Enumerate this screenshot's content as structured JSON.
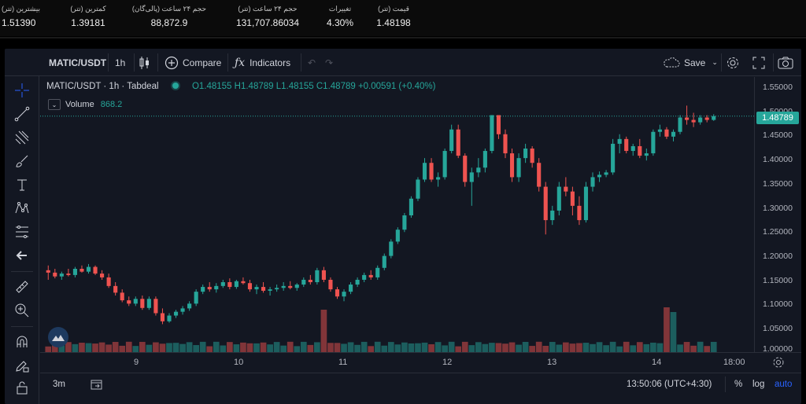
{
  "stats": [
    {
      "label": "بیشترین (تتر)",
      "value": "1.51390"
    },
    {
      "label": "کمترین (تتر)",
      "value": "1.39181"
    },
    {
      "label": "حجم ۲۴ ساعت (پالی‌گان)",
      "value": "88,872.9"
    },
    {
      "label": "حجم ۲۴ ساعت (تتر)",
      "value": "131,707.86034"
    },
    {
      "label": "تغییرات",
      "value": "4.30%"
    },
    {
      "label": "قیمت (تتر)",
      "value": "1.48198"
    }
  ],
  "toolbar": {
    "symbol": "MATIC/USDT",
    "interval": "1h",
    "compare": "Compare",
    "indicators": "Indicators",
    "save": "Save"
  },
  "legend": {
    "title": "MATIC/USDT · 1h · Tabdeal",
    "ohlc": "O1.48155  H1.48789  L1.48155  C1.48789  +0.00591 (+0.40%)",
    "volume_label": "Volume",
    "volume_value": "868.2"
  },
  "price_axis": {
    "last_price": "1.48789",
    "ticks": [
      "1.55000",
      "1.50000",
      "1.45000",
      "1.40000",
      "1.35000",
      "1.30000",
      "1.25000",
      "1.20000",
      "1.15000",
      "1.10000",
      "1.05000",
      "1.00000"
    ]
  },
  "time_axis": [
    "9",
    "10",
    "11",
    "12",
    "13",
    "14",
    "18:00"
  ],
  "bottom": {
    "range": "3m",
    "clock": "13:50:06 (UTC+4:30)",
    "percent": "%",
    "log": "log",
    "auto": "auto"
  },
  "colors": {
    "up": "#26a69a",
    "down": "#ef5350",
    "background": "#131722",
    "accent": "#2962ff"
  },
  "chart_data": {
    "type": "candlestick",
    "ylim": [
      1.0,
      1.56
    ],
    "x_ticks": [
      "9",
      "10",
      "11",
      "12",
      "13",
      "14",
      "18:00"
    ],
    "candles": [
      [
        1.165,
        1.175,
        1.145,
        1.16
      ],
      [
        1.16,
        1.168,
        1.148,
        1.152
      ],
      [
        1.152,
        1.162,
        1.145,
        1.158
      ],
      [
        1.158,
        1.168,
        1.152,
        1.155
      ],
      [
        1.155,
        1.172,
        1.15,
        1.168
      ],
      [
        1.168,
        1.175,
        1.16,
        1.162
      ],
      [
        1.162,
        1.178,
        1.158,
        1.172
      ],
      [
        1.172,
        1.175,
        1.155,
        1.158
      ],
      [
        1.158,
        1.165,
        1.145,
        1.15
      ],
      [
        1.15,
        1.158,
        1.128,
        1.132
      ],
      [
        1.132,
        1.14,
        1.112,
        1.118
      ],
      [
        1.118,
        1.125,
        1.098,
        1.102
      ],
      [
        1.102,
        1.11,
        1.09,
        1.095
      ],
      [
        1.095,
        1.11,
        1.09,
        1.105
      ],
      [
        1.105,
        1.112,
        1.082,
        1.086
      ],
      [
        1.086,
        1.11,
        1.082,
        1.105
      ],
      [
        1.105,
        1.11,
        1.07,
        1.075
      ],
      [
        1.075,
        1.085,
        1.052,
        1.058
      ],
      [
        1.058,
        1.075,
        1.055,
        1.07
      ],
      [
        1.07,
        1.082,
        1.065,
        1.078
      ],
      [
        1.078,
        1.09,
        1.072,
        1.085
      ],
      [
        1.085,
        1.1,
        1.08,
        1.095
      ],
      [
        1.095,
        1.125,
        1.09,
        1.12
      ],
      [
        1.12,
        1.135,
        1.115,
        1.13
      ],
      [
        1.13,
        1.14,
        1.12,
        1.125
      ],
      [
        1.125,
        1.138,
        1.118,
        1.132
      ],
      [
        1.132,
        1.145,
        1.128,
        1.14
      ],
      [
        1.14,
        1.148,
        1.125,
        1.13
      ],
      [
        1.13,
        1.145,
        1.126,
        1.142
      ],
      [
        1.142,
        1.15,
        1.135,
        1.138
      ],
      [
        1.138,
        1.145,
        1.12,
        1.125
      ],
      [
        1.125,
        1.135,
        1.115,
        1.13
      ],
      [
        1.13,
        1.14,
        1.118,
        1.122
      ],
      [
        1.122,
        1.13,
        1.112,
        1.125
      ],
      [
        1.125,
        1.135,
        1.12,
        1.128
      ],
      [
        1.128,
        1.14,
        1.122,
        1.132
      ],
      [
        1.132,
        1.142,
        1.125,
        1.128
      ],
      [
        1.128,
        1.138,
        1.122,
        1.135
      ],
      [
        1.135,
        1.15,
        1.13,
        1.145
      ],
      [
        1.145,
        1.155,
        1.135,
        1.14
      ],
      [
        1.14,
        1.17,
        1.135,
        1.165
      ],
      [
        1.165,
        1.172,
        1.14,
        1.145
      ],
      [
        1.145,
        1.15,
        1.12,
        1.125
      ],
      [
        1.125,
        1.13,
        1.105,
        1.11
      ],
      [
        1.11,
        1.125,
        1.1,
        1.12
      ],
      [
        1.12,
        1.14,
        1.115,
        1.135
      ],
      [
        1.135,
        1.15,
        1.13,
        1.145
      ],
      [
        1.145,
        1.16,
        1.14,
        1.155
      ],
      [
        1.155,
        1.165,
        1.145,
        1.15
      ],
      [
        1.15,
        1.175,
        1.145,
        1.17
      ],
      [
        1.17,
        1.2,
        1.165,
        1.195
      ],
      [
        1.195,
        1.23,
        1.19,
        1.225
      ],
      [
        1.225,
        1.255,
        1.22,
        1.25
      ],
      [
        1.25,
        1.285,
        1.245,
        1.28
      ],
      [
        1.28,
        1.32,
        1.275,
        1.315
      ],
      [
        1.315,
        1.36,
        1.31,
        1.355
      ],
      [
        1.355,
        1.4,
        1.35,
        1.39
      ],
      [
        1.39,
        1.4,
        1.35,
        1.355
      ],
      [
        1.355,
        1.37,
        1.34,
        1.36
      ],
      [
        1.36,
        1.42,
        1.355,
        1.415
      ],
      [
        1.415,
        1.47,
        1.41,
        1.46
      ],
      [
        1.46,
        1.47,
        1.4,
        1.405
      ],
      [
        1.405,
        1.41,
        1.34,
        1.35
      ],
      [
        1.35,
        1.38,
        1.3,
        1.37
      ],
      [
        1.37,
        1.4,
        1.36,
        1.38
      ],
      [
        1.38,
        1.42,
        1.37,
        1.415
      ],
      [
        1.415,
        1.49,
        1.41,
        1.49
      ],
      [
        1.49,
        1.49,
        1.44,
        1.45
      ],
      [
        1.45,
        1.46,
        1.4,
        1.41
      ],
      [
        1.41,
        1.42,
        1.35,
        1.36
      ],
      [
        1.36,
        1.41,
        1.35,
        1.4
      ],
      [
        1.4,
        1.43,
        1.39,
        1.42
      ],
      [
        1.42,
        1.425,
        1.38,
        1.39
      ],
      [
        1.39,
        1.4,
        1.33,
        1.34
      ],
      [
        1.34,
        1.35,
        1.24,
        1.27
      ],
      [
        1.27,
        1.3,
        1.26,
        1.29
      ],
      [
        1.29,
        1.35,
        1.28,
        1.34
      ],
      [
        1.34,
        1.36,
        1.32,
        1.33
      ],
      [
        1.33,
        1.34,
        1.28,
        1.3
      ],
      [
        1.3,
        1.32,
        1.26,
        1.27
      ],
      [
        1.27,
        1.35,
        1.265,
        1.34
      ],
      [
        1.34,
        1.37,
        1.33,
        1.36
      ],
      [
        1.36,
        1.372,
        1.35,
        1.365
      ],
      [
        1.365,
        1.375,
        1.36,
        1.37
      ],
      [
        1.37,
        1.44,
        1.365,
        1.43
      ],
      [
        1.43,
        1.45,
        1.41,
        1.44
      ],
      [
        1.44,
        1.445,
        1.41,
        1.415
      ],
      [
        1.415,
        1.43,
        1.405,
        1.425
      ],
      [
        1.425,
        1.44,
        1.4,
        1.405
      ],
      [
        1.405,
        1.42,
        1.395,
        1.41
      ],
      [
        1.41,
        1.46,
        1.405,
        1.455
      ],
      [
        1.455,
        1.47,
        1.445,
        1.46
      ],
      [
        1.46,
        1.465,
        1.44,
        1.445
      ],
      [
        1.445,
        1.46,
        1.435,
        1.455
      ],
      [
        1.455,
        1.49,
        1.45,
        1.485
      ],
      [
        1.485,
        1.51,
        1.47,
        1.48
      ],
      [
        1.48,
        1.495,
        1.465,
        1.475
      ],
      [
        1.475,
        1.49,
        1.47,
        1.485
      ],
      [
        1.485,
        1.49,
        1.475,
        1.48
      ],
      [
        1.48,
        1.492,
        1.478,
        1.488
      ]
    ],
    "volume_spikes": [
      [
        41,
        0.9
      ],
      [
        92,
        0.95
      ],
      [
        93,
        0.85
      ]
    ]
  }
}
